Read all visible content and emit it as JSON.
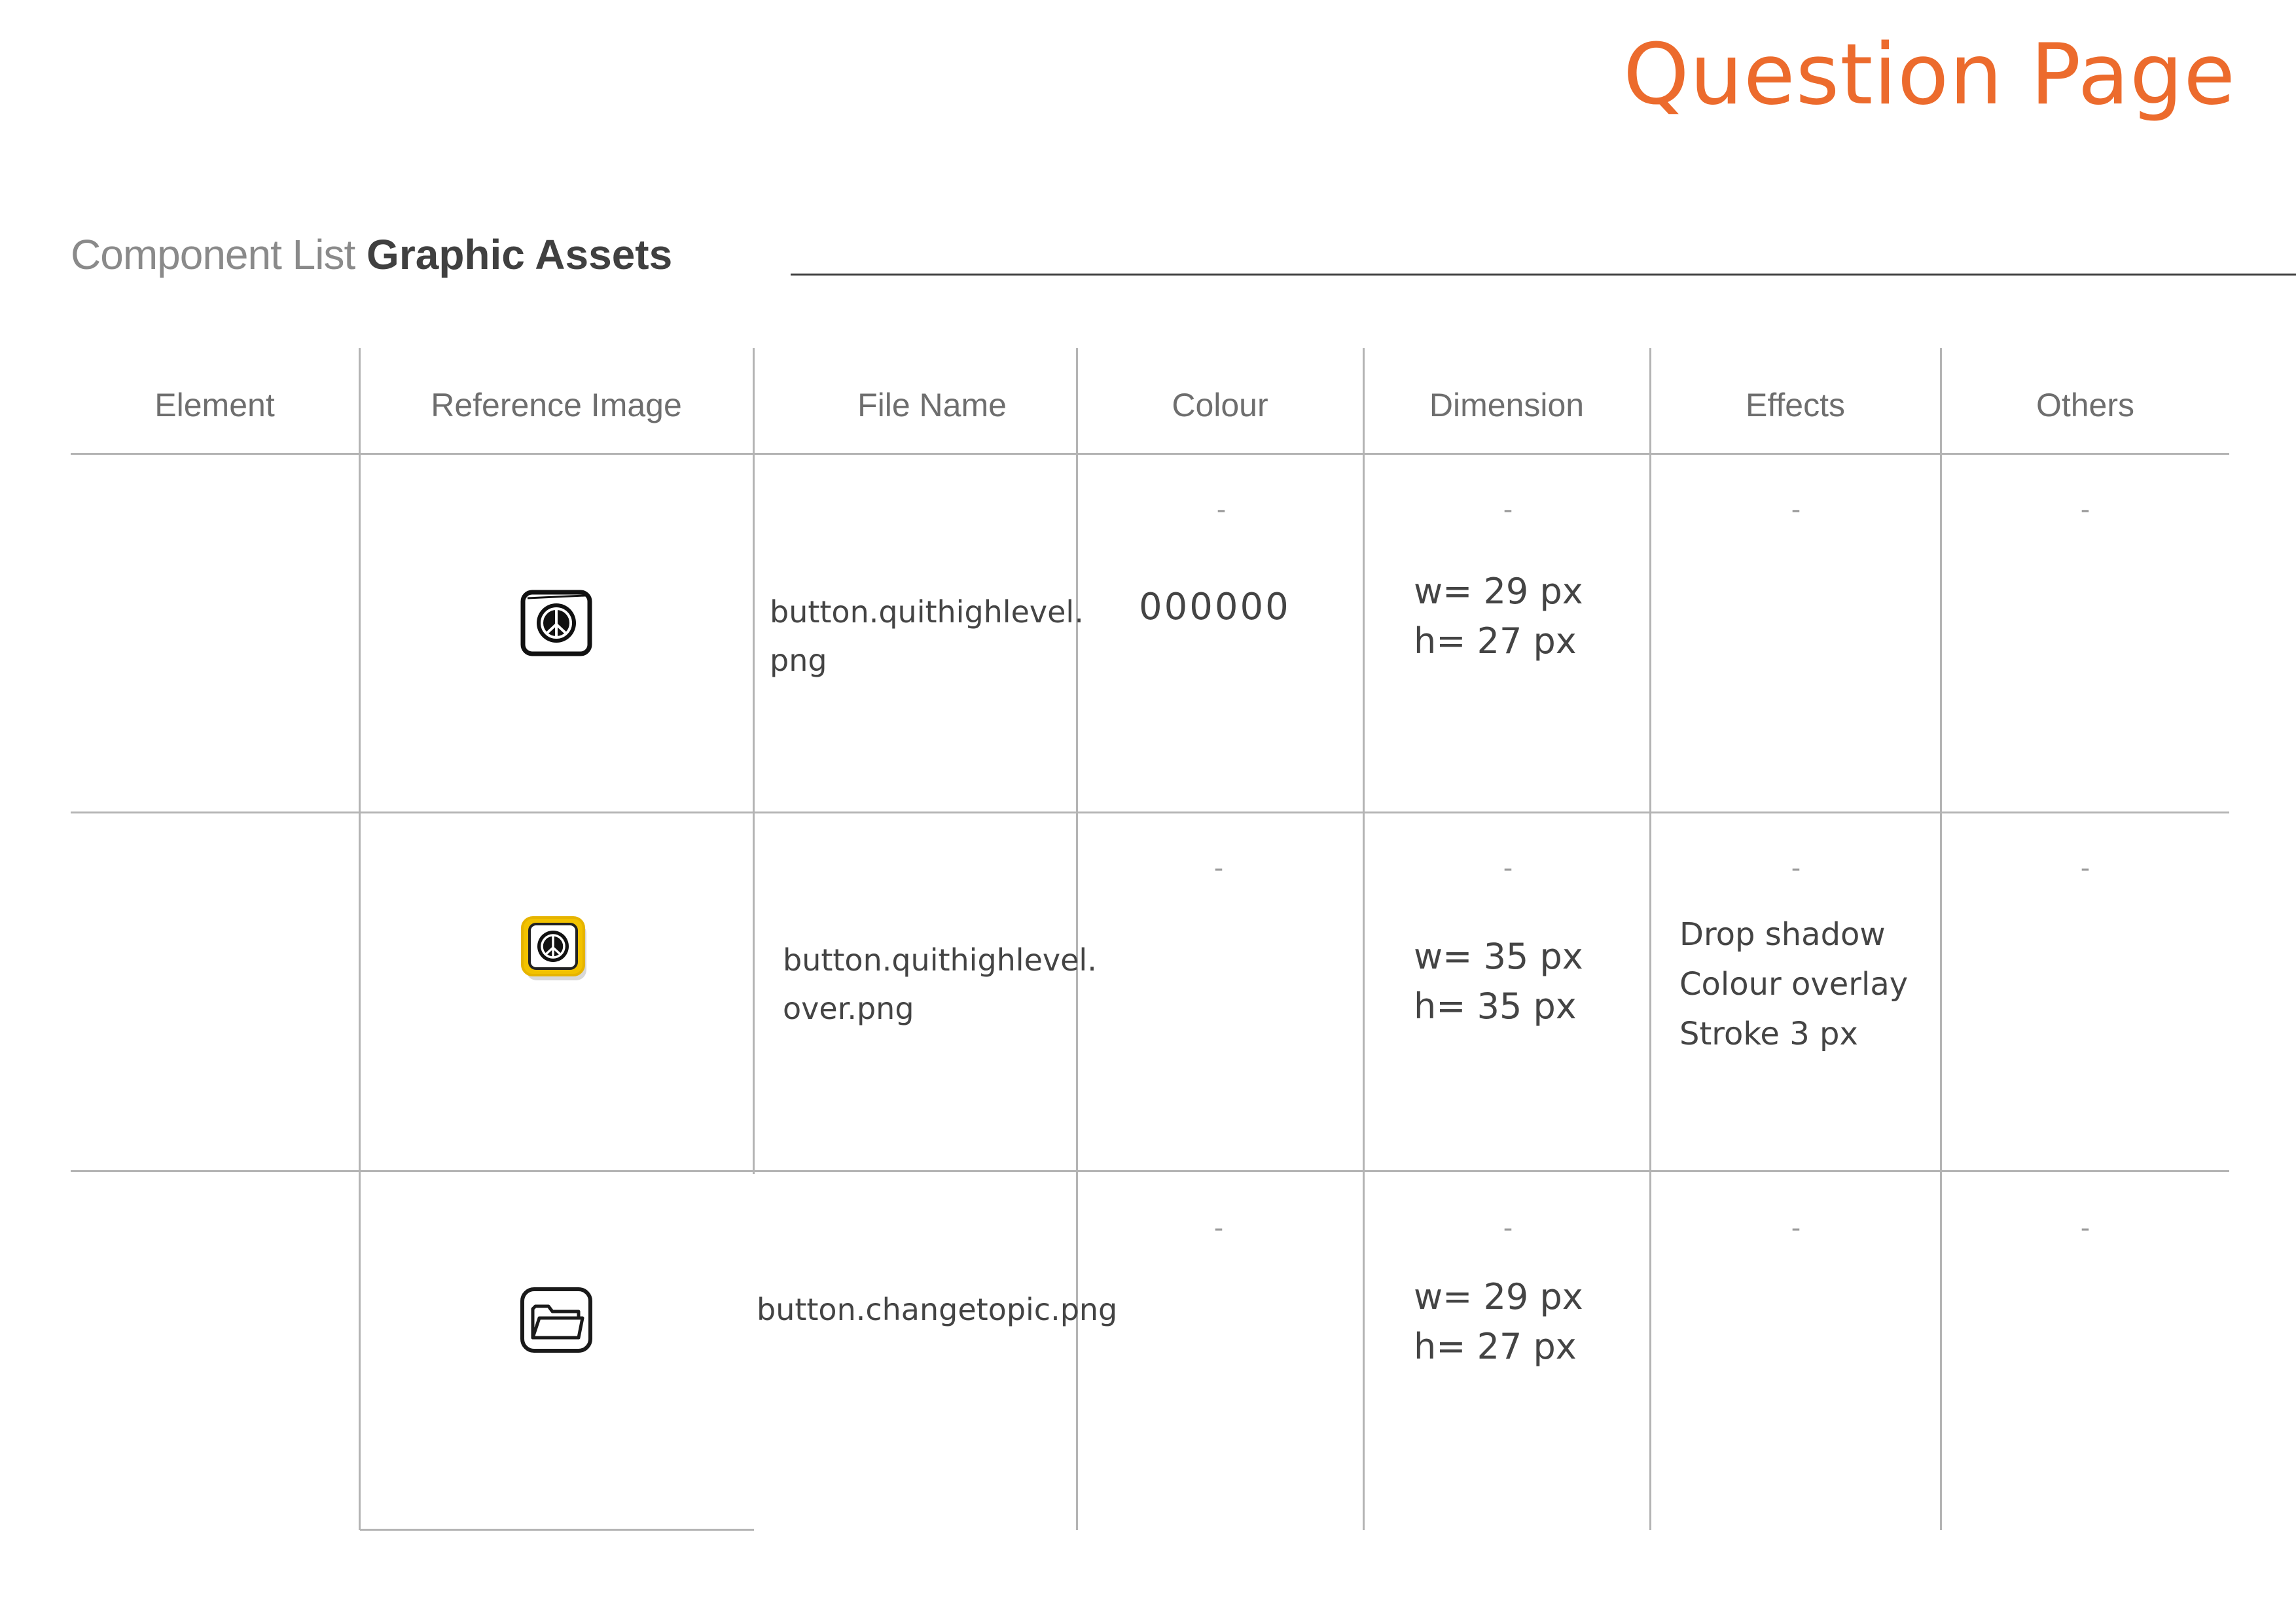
{
  "page": {
    "title": "Question Page",
    "section_light": "Component List",
    "section_bold": "Graphic Assets",
    "accent_color": "#ec6b2d"
  },
  "table": {
    "columns": [
      "Element",
      "Reference Image",
      "File Name",
      "Colour",
      "Dimension",
      "Effects",
      "Others"
    ],
    "rows": [
      {
        "element": "",
        "reference_icon": "peace-symbol-icon",
        "file_name": [
          "button.quithighlevel.",
          "png"
        ],
        "colour": {
          "mark": "-",
          "value": "000000"
        },
        "dimension": {
          "mark": "-",
          "lines": [
            "w= 29 px",
            "h= 27 px"
          ]
        },
        "effects": {
          "mark": "-",
          "lines": []
        },
        "others": {
          "mark": "-"
        }
      },
      {
        "element": "",
        "reference_icon": "peace-symbol-highlighted-icon",
        "file_name": [
          "button.quithighlevel.",
          "over.png"
        ],
        "colour": {
          "mark": "-",
          "value": ""
        },
        "dimension": {
          "mark": "-",
          "lines": [
            "w= 35 px",
            "h= 35 px"
          ]
        },
        "effects": {
          "mark": "-",
          "lines": [
            "Drop shadow",
            "Colour overlay",
            "Stroke 3 px"
          ]
        },
        "others": {
          "mark": "-"
        }
      },
      {
        "element": "",
        "reference_icon": "folder-icon",
        "file_name": [
          "button.changetopic.png"
        ],
        "colour": {
          "mark": "-",
          "value": ""
        },
        "dimension": {
          "mark": "-",
          "lines": [
            "w= 29 px",
            "h= 27 px"
          ]
        },
        "effects": {
          "mark": "-",
          "lines": []
        },
        "others": {
          "mark": "-"
        }
      }
    ]
  }
}
